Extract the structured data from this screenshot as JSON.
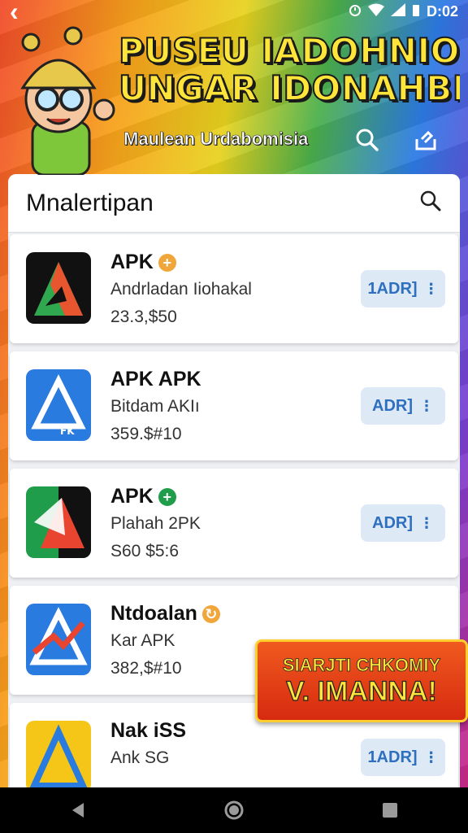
{
  "status_bar": {
    "time": "D:02",
    "back_glyph": "‹"
  },
  "hero": {
    "title_line1": "PUSEU IADOHNIOM",
    "title_line2": "UNGAR IDONAHBIA",
    "subtitle": "Maulean Urdabomisia",
    "icons": [
      "search-icon",
      "share-icon"
    ]
  },
  "search": {
    "title": "Mnalertipan",
    "icon": "search-icon"
  },
  "apps": [
    {
      "name": "APK",
      "badge": "+",
      "badge_color": "#f0a63a",
      "desc": "Andrladan Iiohakal",
      "price": "23.3,$50",
      "button": "1ADR]",
      "icon_colors": [
        "#111111",
        "#2fa84f",
        "#e8562f"
      ]
    },
    {
      "name": "APK APK",
      "badge": "",
      "badge_color": "",
      "desc": "Bitdam AKIı",
      "price": "359.$#10",
      "button": "ADR]",
      "icon_colors": [
        "#2a7be0",
        "#ffffff"
      ]
    },
    {
      "name": "APK",
      "badge": "+",
      "badge_color": "#1f9d4a",
      "desc": "Plahah 2PK",
      "price": "S60 $5:6",
      "button": "ADR]",
      "icon_colors": [
        "#1f9d4a",
        "#111111",
        "#e8442f"
      ]
    },
    {
      "name": "Ntdoalan",
      "badge": "↻",
      "badge_color": "#f0a63a",
      "desc": "Kar APK",
      "price": "382,$#10",
      "button": "",
      "icon_colors": [
        "#2a7be0",
        "#e8442f"
      ]
    },
    {
      "name": "Nak iSS",
      "badge": "",
      "badge_color": "",
      "desc": "Ank SG",
      "price": "",
      "button": "1ADR]",
      "icon_colors": [
        "#2a7be0",
        "#f5c518"
      ]
    }
  ],
  "promo": {
    "line1": "SIARJTI CHKOMIY",
    "line2": "V. IMANNA!"
  },
  "nav": {
    "items": [
      "back-icon",
      "home-icon",
      "recents-icon"
    ]
  },
  "colors": {
    "accent": "#2f6fbf",
    "title_yellow": "#ffe53a",
    "button_bg": "#dde9f5"
  }
}
